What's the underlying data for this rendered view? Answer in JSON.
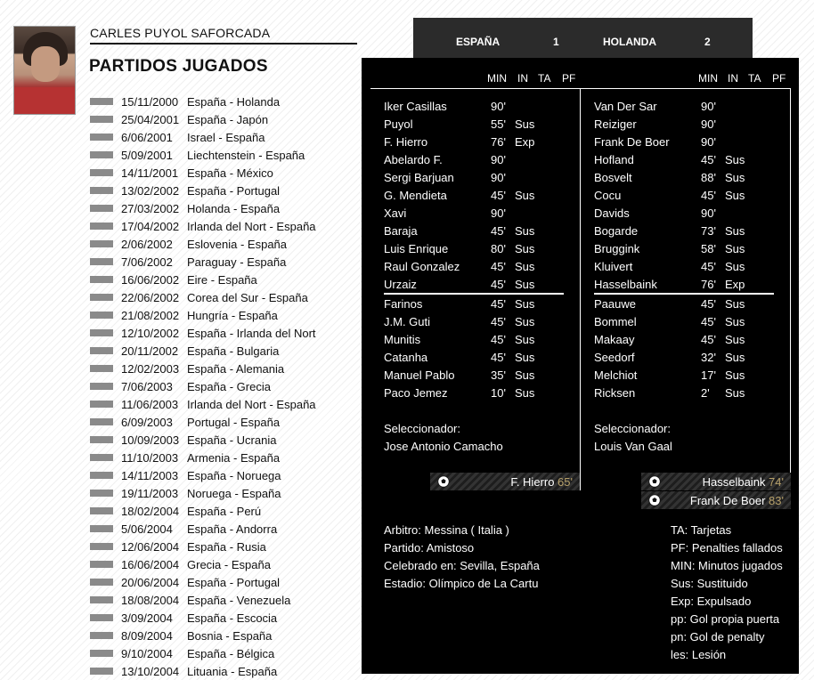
{
  "player": {
    "name": "CARLES PUYOL SAFORCADA"
  },
  "section_title": "PARTIDOS JUGADOS",
  "matches": [
    {
      "date": "15/11/2000",
      "teams": "España - Holanda"
    },
    {
      "date": "25/04/2001",
      "teams": "España - Japón"
    },
    {
      "date": "6/06/2001",
      "teams": "Israel - España"
    },
    {
      "date": "5/09/2001",
      "teams": "Liechtenstein - España"
    },
    {
      "date": "14/11/2001",
      "teams": "España - México"
    },
    {
      "date": "13/02/2002",
      "teams": "España - Portugal"
    },
    {
      "date": "27/03/2002",
      "teams": "Holanda - España"
    },
    {
      "date": "17/04/2002",
      "teams": "Irlanda del Nort - España"
    },
    {
      "date": "2/06/2002",
      "teams": "Eslovenia - España"
    },
    {
      "date": "7/06/2002",
      "teams": "Paraguay - España"
    },
    {
      "date": "16/06/2002",
      "teams": "Eire - España"
    },
    {
      "date": "22/06/2002",
      "teams": "Corea del Sur - España"
    },
    {
      "date": "21/08/2002",
      "teams": "Hungría - España"
    },
    {
      "date": "12/10/2002",
      "teams": "España - Irlanda del Nort"
    },
    {
      "date": "20/11/2002",
      "teams": "España - Bulgaria"
    },
    {
      "date": "12/02/2003",
      "teams": "España - Alemania"
    },
    {
      "date": "7/06/2003",
      "teams": "España - Grecia"
    },
    {
      "date": "11/06/2003",
      "teams": "Irlanda del Nort - España"
    },
    {
      "date": "6/09/2003",
      "teams": "Portugal - España"
    },
    {
      "date": "10/09/2003",
      "teams": "España - Ucrania"
    },
    {
      "date": "11/10/2003",
      "teams": "Armenia - España"
    },
    {
      "date": "14/11/2003",
      "teams": "España - Noruega"
    },
    {
      "date": "19/11/2003",
      "teams": "Noruega - España"
    },
    {
      "date": "18/02/2004",
      "teams": "España - Perú"
    },
    {
      "date": "5/06/2004",
      "teams": "España - Andorra"
    },
    {
      "date": "12/06/2004",
      "teams": "España - Rusia"
    },
    {
      "date": "16/06/2004",
      "teams": "Grecia - España"
    },
    {
      "date": "20/06/2004",
      "teams": "España - Portugal"
    },
    {
      "date": "18/08/2004",
      "teams": "España - Venezuela"
    },
    {
      "date": "3/09/2004",
      "teams": "España - Escocia"
    },
    {
      "date": "8/09/2004",
      "teams": "Bosnia - España"
    },
    {
      "date": "9/10/2004",
      "teams": "España - Bélgica"
    },
    {
      "date": "13/10/2004",
      "teams": "Lituania - España"
    }
  ],
  "score": {
    "home_team": "ESPAÑA",
    "home_goals": "1",
    "away_team": "HOLANDA",
    "away_goals": "2"
  },
  "columns": {
    "min": "MIN",
    "in": "IN",
    "ta": "TA",
    "pf": "PF"
  },
  "home": {
    "starters": [
      {
        "name": "Iker Casillas",
        "min": "90'",
        "in": ""
      },
      {
        "name": "Puyol",
        "min": "55'",
        "in": "Sus"
      },
      {
        "name": "F. Hierro",
        "min": "76'",
        "in": "Exp"
      },
      {
        "name": "Abelardo F.",
        "min": "90'",
        "in": ""
      },
      {
        "name": "Sergi Barjuan",
        "min": "90'",
        "in": ""
      },
      {
        "name": "G. Mendieta",
        "min": "45'",
        "in": "Sus"
      },
      {
        "name": "Xavi",
        "min": "90'",
        "in": ""
      },
      {
        "name": "Baraja",
        "min": "45'",
        "in": "Sus"
      },
      {
        "name": "Luis Enrique",
        "min": "80'",
        "in": "Sus"
      },
      {
        "name": "Raul Gonzalez",
        "min": "45'",
        "in": "Sus"
      },
      {
        "name": "Urzaiz",
        "min": "45'",
        "in": "Sus"
      }
    ],
    "subs": [
      {
        "name": "Farinos",
        "min": "45'",
        "in": "Sus"
      },
      {
        "name": "J.M. Guti",
        "min": "45'",
        "in": "Sus"
      },
      {
        "name": "Munitis",
        "min": "45'",
        "in": "Sus"
      },
      {
        "name": "Catanha",
        "min": "45'",
        "in": "Sus"
      },
      {
        "name": "Manuel Pablo",
        "min": "35'",
        "in": "Sus"
      },
      {
        "name": "Paco Jemez",
        "min": "10'",
        "in": "Sus"
      }
    ],
    "coach_label": "Seleccionador:",
    "coach": "Jose Antonio Camacho",
    "goals": [
      {
        "scorer": "F. Hierro",
        "minute": "65'"
      }
    ]
  },
  "away": {
    "starters": [
      {
        "name": "Van Der Sar",
        "min": "90'",
        "in": ""
      },
      {
        "name": "Reiziger",
        "min": "90'",
        "in": ""
      },
      {
        "name": "Frank De Boer",
        "min": "90'",
        "in": ""
      },
      {
        "name": "Hofland",
        "min": "45'",
        "in": "Sus"
      },
      {
        "name": "Bosvelt",
        "min": "88'",
        "in": "Sus"
      },
      {
        "name": "Cocu",
        "min": "45'",
        "in": "Sus"
      },
      {
        "name": "Davids",
        "min": "90'",
        "in": ""
      },
      {
        "name": "Bogarde",
        "min": "73'",
        "in": "Sus"
      },
      {
        "name": "Bruggink",
        "min": "58'",
        "in": "Sus"
      },
      {
        "name": "Kluivert",
        "min": "45'",
        "in": "Sus"
      },
      {
        "name": "Hasselbaink",
        "min": "76'",
        "in": "Exp"
      }
    ],
    "subs": [
      {
        "name": "Paauwe",
        "min": "45'",
        "in": "Sus"
      },
      {
        "name": "Bommel",
        "min": "45'",
        "in": "Sus"
      },
      {
        "name": "Makaay",
        "min": "45'",
        "in": "Sus"
      },
      {
        "name": "Seedorf",
        "min": "32'",
        "in": "Sus"
      },
      {
        "name": "Melchiot",
        "min": "17'",
        "in": "Sus"
      },
      {
        "name": "Ricksen",
        "min": "2'",
        "in": "Sus"
      }
    ],
    "coach_label": "Seleccionador:",
    "coach": "Louis Van Gaal",
    "goals": [
      {
        "scorer": "Hasselbaink",
        "minute": "74'"
      },
      {
        "scorer": "Frank De Boer",
        "minute": "83'"
      }
    ]
  },
  "match_info": [
    "Arbitro: Messina ( Italia )",
    "Partido: Amistoso",
    "Celebrado en: Sevilla, España",
    "Estadio: Olímpico de La Cartu"
  ],
  "legend": [
    "TA: Tarjetas",
    "PF: Penalties fallados",
    "MIN: Minutos jugados",
    "Sus: Sustituido",
    "Exp: Expulsado",
    "pp: Gol propia puerta",
    "pn: Gol de penalty",
    "les: Lesión"
  ],
  "icons": {
    "goal": "soccer-ball-icon",
    "marker": "match-marker-icon"
  },
  "colors": {
    "panel": "#000000",
    "scorebar": "#2b2b2b",
    "marker": "#8a8a8a",
    "goal_minute": "#b6a06a"
  }
}
